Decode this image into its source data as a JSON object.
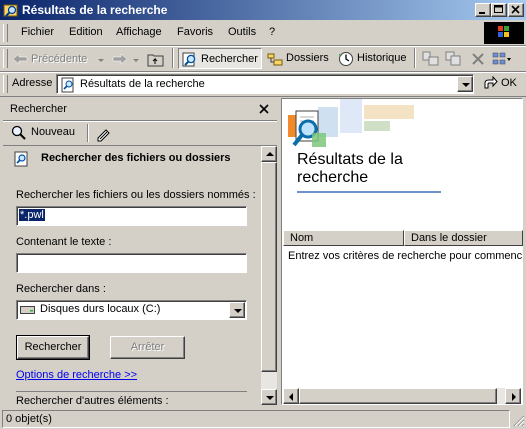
{
  "window": {
    "title": "Résultats de la recherche"
  },
  "menu": {
    "items": [
      "Fichier",
      "Edition",
      "Affichage",
      "Favoris",
      "Outils",
      "?"
    ]
  },
  "toolbar": {
    "back_label": "Précédente",
    "search_label": "Rechercher",
    "folders_label": "Dossiers",
    "history_label": "Historique"
  },
  "address": {
    "label": "Adresse",
    "value": "Résultats de la recherche",
    "go_label": "OK"
  },
  "search_pane": {
    "title": "Rechercher",
    "new_label": "Nouveau",
    "heading": "Rechercher des fichiers ou dossiers",
    "name_label": "Rechercher les fichiers ou les dossiers nommés :",
    "name_value": "*.pwl",
    "text_label": "Contenant le texte :",
    "text_value": "",
    "location_label": "Rechercher dans :",
    "location_value": "Disques durs locaux (C:)",
    "search_button": "Rechercher",
    "stop_button": "Arrêter",
    "options_link": "Options de recherche >>",
    "other_items_label": "Rechercher d'autres éléments :"
  },
  "results": {
    "title": "Résultats de la recherche",
    "columns": [
      "Nom",
      "Dans le dossier"
    ],
    "empty_message": "Entrez vos critères de recherche pour commencer"
  },
  "status": {
    "text": "0 objet(s)"
  },
  "colors": {
    "title_start": "#0a246a",
    "title_end": "#a6caf0",
    "face": "#d4d0c8",
    "link": "#0000ee"
  },
  "icons": [
    "explorer-icon",
    "back-arrow-icon",
    "forward-arrow-icon",
    "up-folder-icon",
    "search-icon",
    "folders-icon",
    "history-icon",
    "move-to-icon",
    "copy-to-icon",
    "delete-icon",
    "page-icon",
    "go-arrow-icon",
    "magnifier-icon",
    "new-search-icon",
    "search-doc-icon",
    "drive-icon",
    "results-magnifier-icon"
  ]
}
